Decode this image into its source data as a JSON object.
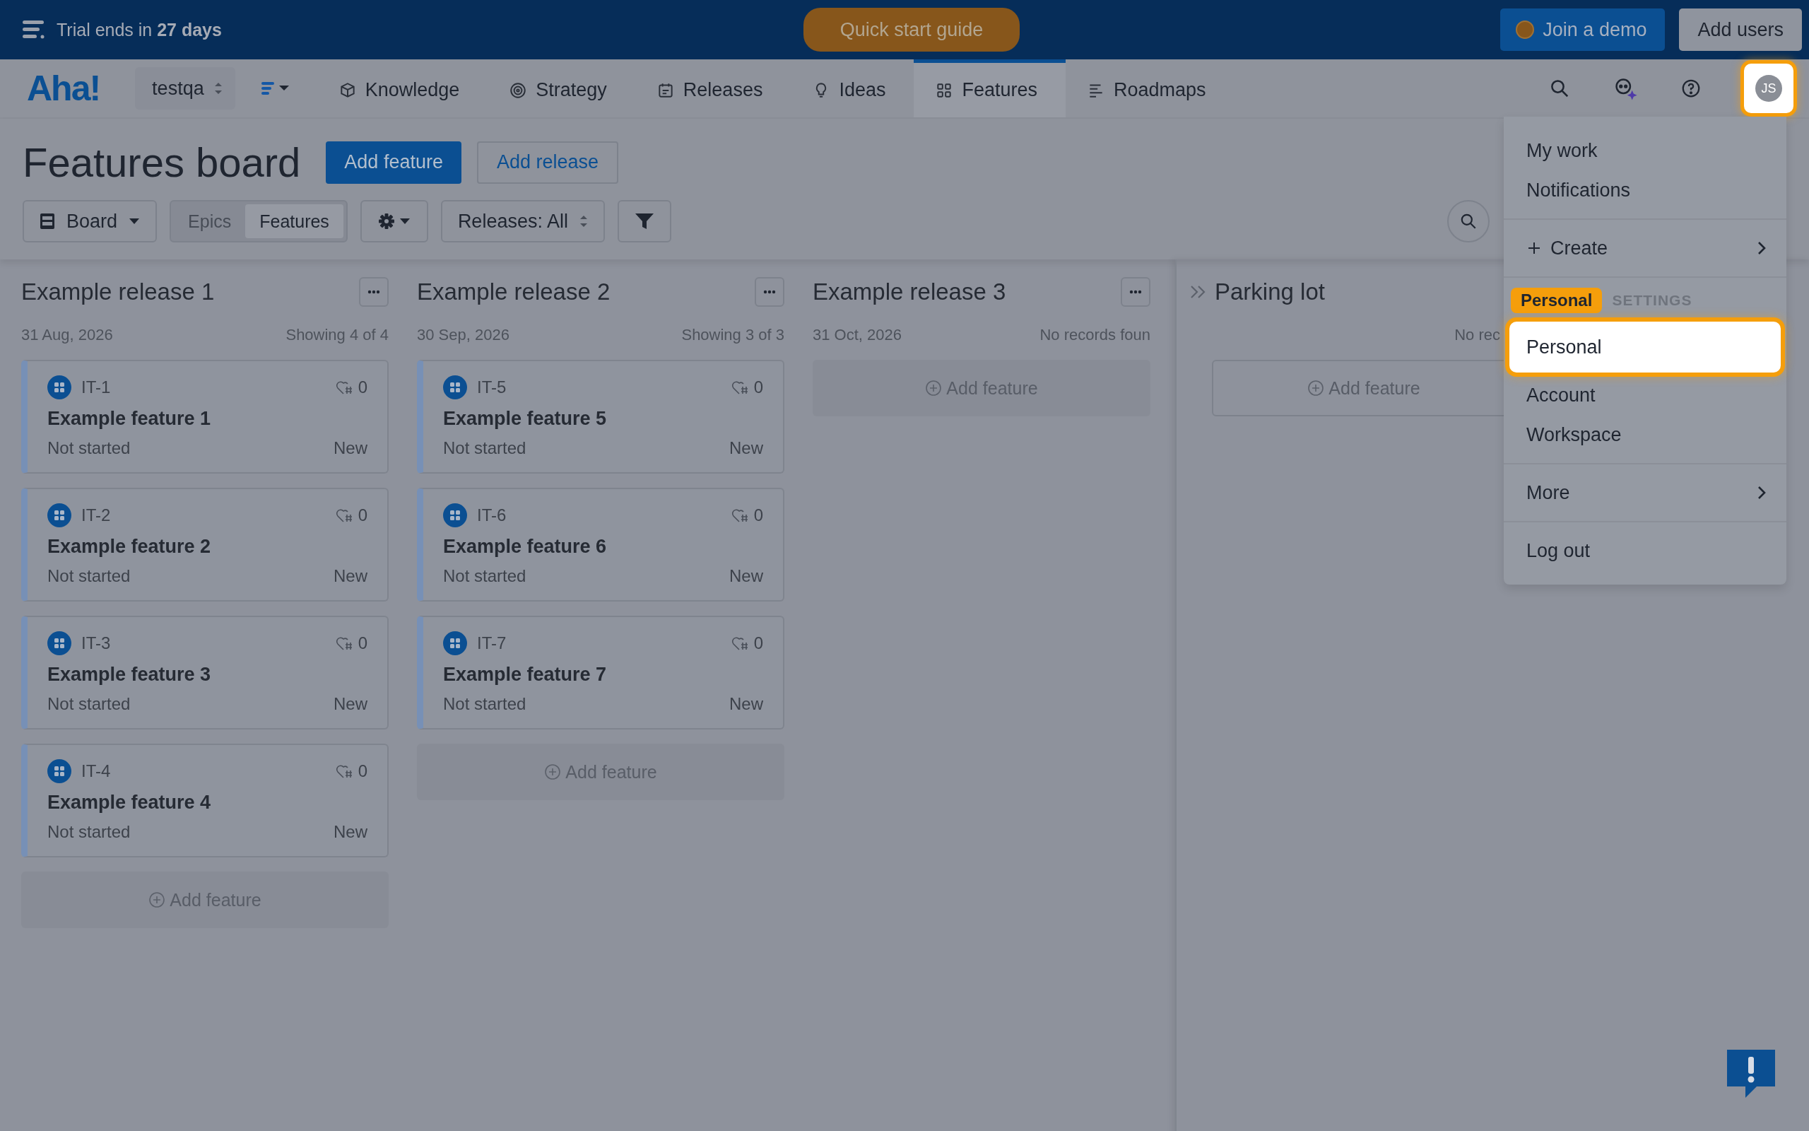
{
  "banner": {
    "trial": "Trial ends in **27 days**",
    "quick_start": "Quick start guide",
    "join_demo": "Join a demo",
    "add_users": "Add users"
  },
  "nav": {
    "logo": "Aha!",
    "workspace": "testqa",
    "tabs": [
      {
        "label": "Knowledge",
        "selected": false
      },
      {
        "label": "Strategy",
        "selected": false
      },
      {
        "label": "Releases",
        "selected": false
      },
      {
        "label": "Ideas",
        "selected": false
      },
      {
        "label": "Features",
        "selected": true
      },
      {
        "label": "Roadmaps",
        "selected": false
      }
    ],
    "avatar": {
      "initials": "JS",
      "highlighted": true
    }
  },
  "header": {
    "title": "Features board",
    "add_feature": "Add feature",
    "add_release": "Add release"
  },
  "toolbar": {
    "view": "Board",
    "segments": [
      {
        "label": "Epics",
        "selected": false
      },
      {
        "label": "Features",
        "selected": true
      }
    ],
    "releases": "Releases: All"
  },
  "columns": [
    {
      "title": "Example release 1",
      "date": "31 Aug, 2026",
      "count": "Showing 4 of 4",
      "add_label": "Add feature",
      "cards": [
        {
          "id": "IT-1",
          "name": "Example feature 1",
          "status": "Not started",
          "workflow": "New",
          "score": "0"
        },
        {
          "id": "IT-2",
          "name": "Example feature 2",
          "status": "Not started",
          "workflow": "New",
          "score": "0"
        },
        {
          "id": "IT-3",
          "name": "Example feature 3",
          "status": "Not started",
          "workflow": "New",
          "score": "0"
        },
        {
          "id": "IT-4",
          "name": "Example feature 4",
          "status": "Not started",
          "workflow": "New",
          "score": "0"
        }
      ]
    },
    {
      "title": "Example release 2",
      "date": "30 Sep, 2026",
      "count": "Showing 3 of 3",
      "add_label": "Add feature",
      "cards": [
        {
          "id": "IT-5",
          "name": "Example feature 5",
          "status": "Not started",
          "workflow": "New",
          "score": "0"
        },
        {
          "id": "IT-6",
          "name": "Example feature 6",
          "status": "Not started",
          "workflow": "New",
          "score": "0"
        },
        {
          "id": "IT-7",
          "name": "Example feature 7",
          "status": "Not started",
          "workflow": "New",
          "score": "0"
        }
      ]
    },
    {
      "title": "Example release 3",
      "date": "31 Oct, 2026",
      "count": "No records foun",
      "add_label": "Add feature"
    }
  ],
  "parking_lot": {
    "title": "Parking lot",
    "count": "No rec",
    "add_label": "Add feature"
  },
  "user_menu": {
    "tooltip": "Personal",
    "groups": [
      {
        "items": [
          {
            "kind": "link",
            "label": "My work",
            "highlighted": false
          },
          {
            "kind": "link",
            "label": "Notifications",
            "highlighted": false
          }
        ]
      },
      {
        "items": [
          {
            "kind": "create",
            "label": "Create",
            "highlighted": false
          }
        ]
      },
      {
        "header": "SETTINGS",
        "items": [
          {
            "kind": "link",
            "label": "Personal",
            "highlighted": true
          },
          {
            "kind": "link",
            "label": "Account",
            "highlighted": false
          },
          {
            "kind": "link",
            "label": "Workspace",
            "highlighted": false
          }
        ]
      },
      {
        "items": [
          {
            "kind": "submenu",
            "label": "More",
            "highlighted": false
          }
        ]
      },
      {
        "items": [
          {
            "kind": "link",
            "label": "Log out",
            "highlighted": false
          }
        ]
      }
    ]
  }
}
